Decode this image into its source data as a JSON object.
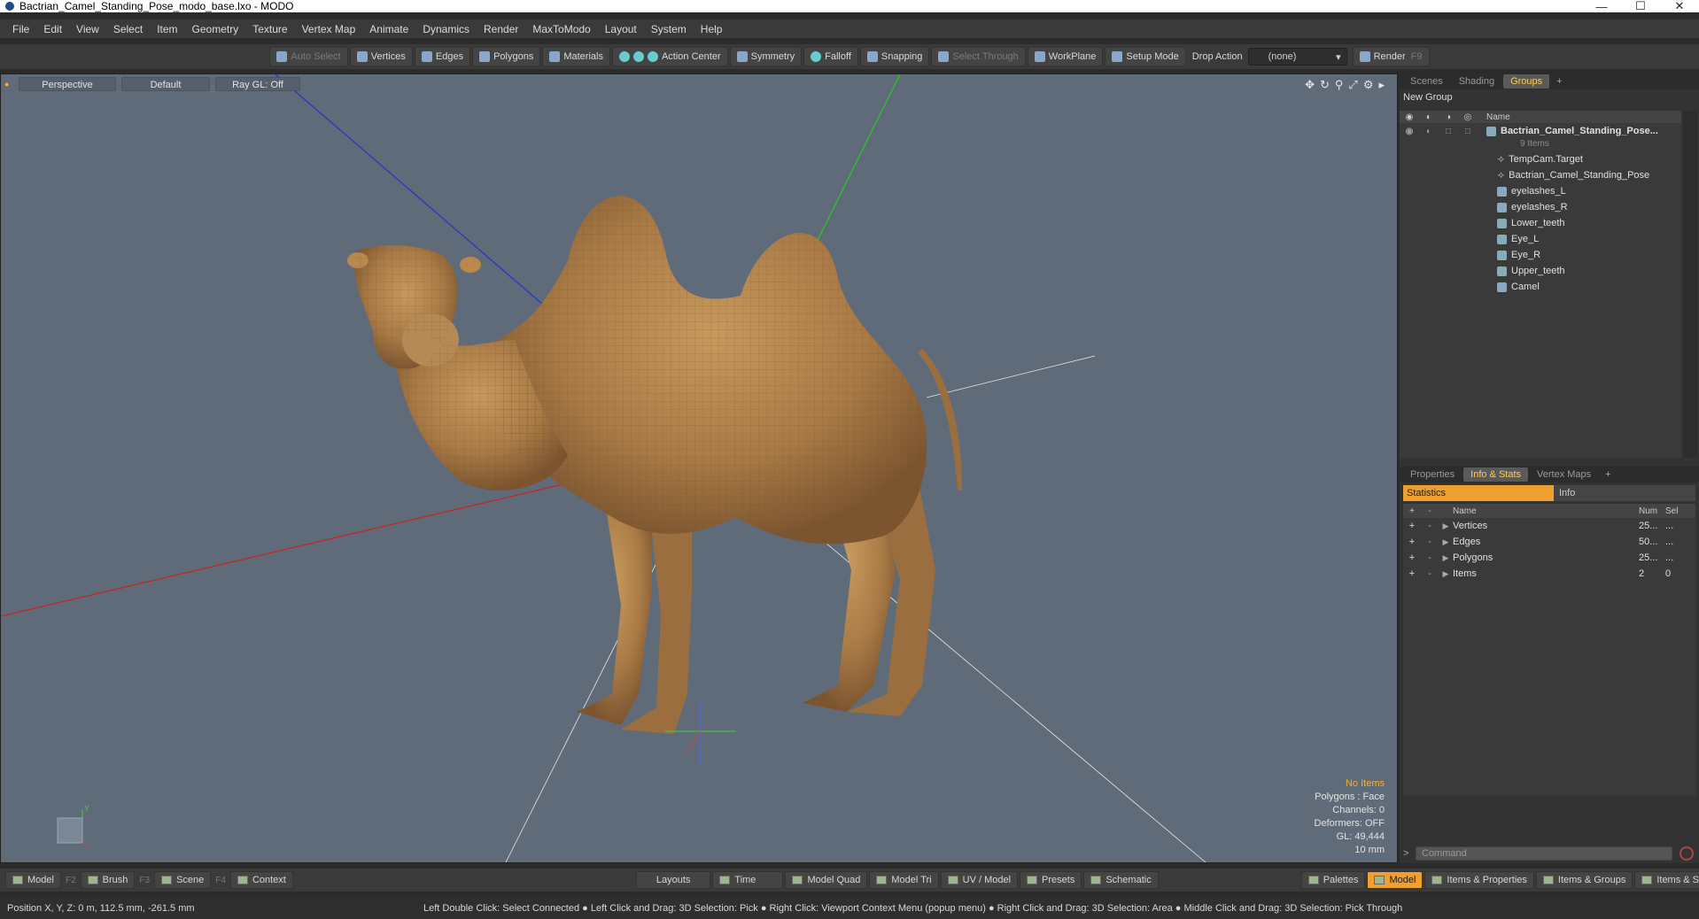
{
  "window": {
    "title": "Bactrian_Camel_Standing_Pose_modo_base.lxo - MODO",
    "min": "—",
    "max": "☐",
    "close": "✕"
  },
  "menu": [
    "File",
    "Edit",
    "View",
    "Select",
    "Item",
    "Geometry",
    "Texture",
    "Vertex Map",
    "Animate",
    "Dynamics",
    "Render",
    "MaxToModo",
    "Layout",
    "System",
    "Help"
  ],
  "toolbar": {
    "auto_select": "Auto Select",
    "vertices": "Vertices",
    "edges": "Edges",
    "polygons": "Polygons",
    "materials": "Materials",
    "action_center": "Action Center",
    "symmetry": "Symmetry",
    "falloff": "Falloff",
    "snapping": "Snapping",
    "select_through": "Select Through",
    "workplane": "WorkPlane",
    "setup_mode": "Setup Mode",
    "drop_action_label": "Drop Action",
    "drop_action_value": "(none)",
    "render": "Render",
    "render_key": "F9"
  },
  "viewport": {
    "view": "Perspective",
    "style": "Default",
    "raygl": "Ray GL: Off",
    "stats": {
      "items": "No Items",
      "polygons": "Polygons : Face",
      "channels": "Channels: 0",
      "deformers": "Deformers: OFF",
      "gl": "GL: 49,444",
      "unit": "10 mm"
    },
    "axis_label": "Y"
  },
  "groups_panel": {
    "tabs": [
      "Scenes",
      "Shading",
      "Groups"
    ],
    "active_tab": "Groups",
    "new_group": "New Group",
    "name_header": "Name",
    "root": "Bactrian_Camel_Standing_Pose...",
    "root_count": "9 Items",
    "items": [
      "TempCam.Target",
      "Bactrian_Camel_Standing_Pose",
      "eyelashes_L",
      "eyelashes_R",
      "Lower_teeth",
      "Eye_L",
      "Eye_R",
      "Upper_teeth",
      "Camel"
    ]
  },
  "info_panel": {
    "tabs": [
      "Properties",
      "Info & Stats",
      "Vertex Maps"
    ],
    "active_tab": "Info & Stats",
    "seg_statistics": "Statistics",
    "seg_info": "Info",
    "head_name": "Name",
    "head_num": "Num",
    "head_sel": "Sel",
    "rows": [
      {
        "name": "Vertices",
        "num": "25...",
        "sel": "..."
      },
      {
        "name": "Edges",
        "num": "50...",
        "sel": "..."
      },
      {
        "name": "Polygons",
        "num": "25...",
        "sel": "..."
      },
      {
        "name": "Items",
        "num": "2",
        "sel": "0"
      }
    ],
    "command_placeholder": "Command"
  },
  "layoutbar": {
    "model": "Model",
    "model_key": "F2",
    "brush": "Brush",
    "brush_key": "F3",
    "scene": "Scene",
    "scene_key": "F4",
    "context": "Context",
    "layouts": "Layouts",
    "time": "Time",
    "model_quad": "Model Quad",
    "model_tri": "Model Tri",
    "uv_model": "UV / Model",
    "presets": "Presets",
    "schematic": "Schematic",
    "palettes": "Palettes",
    "model_active": "Model",
    "items_properties": "Items & Properties",
    "items_groups": "Items & Groups",
    "items_shading": "Items & Shading"
  },
  "status": {
    "position": "Position X, Y, Z:   0 m, 112.5 mm, -261.5 mm",
    "hint": "Left Double Click: Select Connected ● Left Click and Drag: 3D Selection: Pick ● Right Click: Viewport Context Menu (popup menu) ● Right Click and Drag: 3D Selection: Area ● Middle Click and Drag: 3D Selection: Pick Through"
  }
}
